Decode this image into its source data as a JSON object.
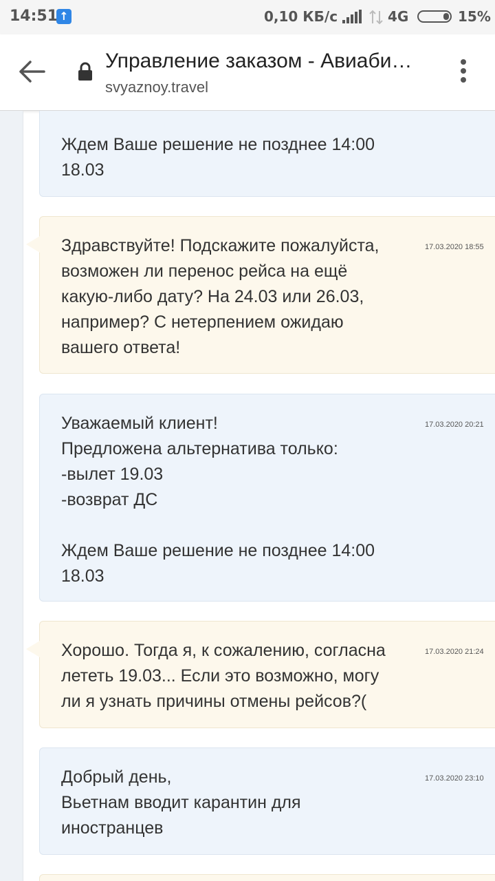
{
  "status_bar": {
    "time": "14:51",
    "speed": "0,10 КБ/с",
    "network": "4G",
    "battery": "15%"
  },
  "toolbar": {
    "title": "Управление заказом - Авиаби…",
    "url": "svyaznoy.travel"
  },
  "messages": [
    {
      "type": "support",
      "date": "",
      "text": "Ждем Ваше решение не позднее 14:00\n18.03"
    },
    {
      "type": "client",
      "date": "17.03.2020 18:55",
      "text": "Здравствуйте! Подскажите пожалуйста,\nвозможен ли перенос рейса на ещё\nкакую-либо дату? На 24.03 или 26.03,\nнапример? С нетерпением ожидаю\nвашего ответа!"
    },
    {
      "type": "support",
      "date": "17.03.2020 20:21",
      "text": "Уважаемый клиент!\nПредложена альтернатива только:\n-вылет 19.03\n-возврат ДС\n\nЖдем Ваше решение не позднее 14:00\n18.03"
    },
    {
      "type": "client",
      "date": "17.03.2020 21:24",
      "text": "Хорошо. Тогда я, к сожалению, согласна\nлететь 19.03... Если это возможно, могу\nли я узнать причины отмены рейсов?("
    },
    {
      "type": "support",
      "date": "17.03.2020 23:10",
      "text": "Добрый день,\nВьетнам вводит карантин для\nиностранцев"
    }
  ],
  "colors": {
    "support_bg": "#eef4fb",
    "client_bg": "#fdf8ec",
    "status_icon": "#2f86e6"
  }
}
